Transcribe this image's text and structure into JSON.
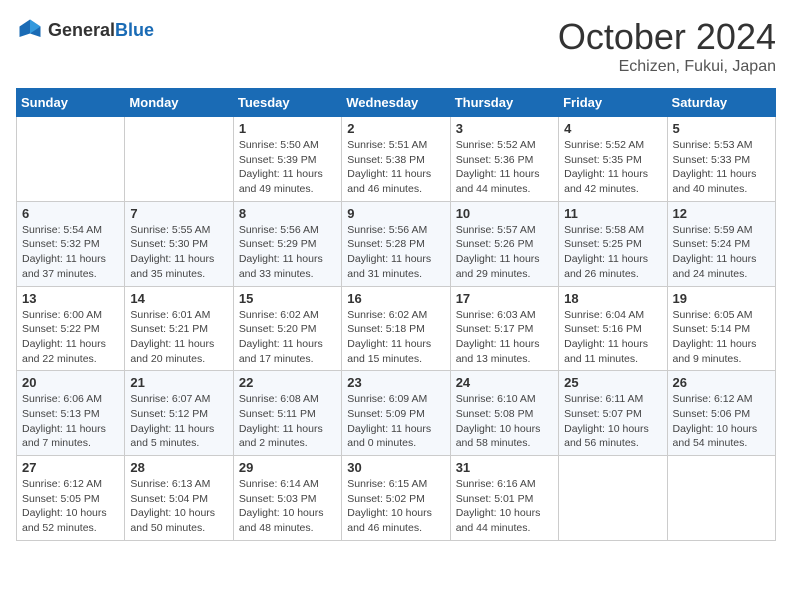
{
  "header": {
    "logo": {
      "general": "General",
      "blue": "Blue"
    },
    "title": "October 2024",
    "location": "Echizen, Fukui, Japan"
  },
  "days_of_week": [
    "Sunday",
    "Monday",
    "Tuesday",
    "Wednesday",
    "Thursday",
    "Friday",
    "Saturday"
  ],
  "weeks": [
    [
      {
        "day": "",
        "sunrise": "",
        "sunset": "",
        "daylight": ""
      },
      {
        "day": "",
        "sunrise": "",
        "sunset": "",
        "daylight": ""
      },
      {
        "day": "1",
        "sunrise": "Sunrise: 5:50 AM",
        "sunset": "Sunset: 5:39 PM",
        "daylight": "Daylight: 11 hours and 49 minutes."
      },
      {
        "day": "2",
        "sunrise": "Sunrise: 5:51 AM",
        "sunset": "Sunset: 5:38 PM",
        "daylight": "Daylight: 11 hours and 46 minutes."
      },
      {
        "day": "3",
        "sunrise": "Sunrise: 5:52 AM",
        "sunset": "Sunset: 5:36 PM",
        "daylight": "Daylight: 11 hours and 44 minutes."
      },
      {
        "day": "4",
        "sunrise": "Sunrise: 5:52 AM",
        "sunset": "Sunset: 5:35 PM",
        "daylight": "Daylight: 11 hours and 42 minutes."
      },
      {
        "day": "5",
        "sunrise": "Sunrise: 5:53 AM",
        "sunset": "Sunset: 5:33 PM",
        "daylight": "Daylight: 11 hours and 40 minutes."
      }
    ],
    [
      {
        "day": "6",
        "sunrise": "Sunrise: 5:54 AM",
        "sunset": "Sunset: 5:32 PM",
        "daylight": "Daylight: 11 hours and 37 minutes."
      },
      {
        "day": "7",
        "sunrise": "Sunrise: 5:55 AM",
        "sunset": "Sunset: 5:30 PM",
        "daylight": "Daylight: 11 hours and 35 minutes."
      },
      {
        "day": "8",
        "sunrise": "Sunrise: 5:56 AM",
        "sunset": "Sunset: 5:29 PM",
        "daylight": "Daylight: 11 hours and 33 minutes."
      },
      {
        "day": "9",
        "sunrise": "Sunrise: 5:56 AM",
        "sunset": "Sunset: 5:28 PM",
        "daylight": "Daylight: 11 hours and 31 minutes."
      },
      {
        "day": "10",
        "sunrise": "Sunrise: 5:57 AM",
        "sunset": "Sunset: 5:26 PM",
        "daylight": "Daylight: 11 hours and 29 minutes."
      },
      {
        "day": "11",
        "sunrise": "Sunrise: 5:58 AM",
        "sunset": "Sunset: 5:25 PM",
        "daylight": "Daylight: 11 hours and 26 minutes."
      },
      {
        "day": "12",
        "sunrise": "Sunrise: 5:59 AM",
        "sunset": "Sunset: 5:24 PM",
        "daylight": "Daylight: 11 hours and 24 minutes."
      }
    ],
    [
      {
        "day": "13",
        "sunrise": "Sunrise: 6:00 AM",
        "sunset": "Sunset: 5:22 PM",
        "daylight": "Daylight: 11 hours and 22 minutes."
      },
      {
        "day": "14",
        "sunrise": "Sunrise: 6:01 AM",
        "sunset": "Sunset: 5:21 PM",
        "daylight": "Daylight: 11 hours and 20 minutes."
      },
      {
        "day": "15",
        "sunrise": "Sunrise: 6:02 AM",
        "sunset": "Sunset: 5:20 PM",
        "daylight": "Daylight: 11 hours and 17 minutes."
      },
      {
        "day": "16",
        "sunrise": "Sunrise: 6:02 AM",
        "sunset": "Sunset: 5:18 PM",
        "daylight": "Daylight: 11 hours and 15 minutes."
      },
      {
        "day": "17",
        "sunrise": "Sunrise: 6:03 AM",
        "sunset": "Sunset: 5:17 PM",
        "daylight": "Daylight: 11 hours and 13 minutes."
      },
      {
        "day": "18",
        "sunrise": "Sunrise: 6:04 AM",
        "sunset": "Sunset: 5:16 PM",
        "daylight": "Daylight: 11 hours and 11 minutes."
      },
      {
        "day": "19",
        "sunrise": "Sunrise: 6:05 AM",
        "sunset": "Sunset: 5:14 PM",
        "daylight": "Daylight: 11 hours and 9 minutes."
      }
    ],
    [
      {
        "day": "20",
        "sunrise": "Sunrise: 6:06 AM",
        "sunset": "Sunset: 5:13 PM",
        "daylight": "Daylight: 11 hours and 7 minutes."
      },
      {
        "day": "21",
        "sunrise": "Sunrise: 6:07 AM",
        "sunset": "Sunset: 5:12 PM",
        "daylight": "Daylight: 11 hours and 5 minutes."
      },
      {
        "day": "22",
        "sunrise": "Sunrise: 6:08 AM",
        "sunset": "Sunset: 5:11 PM",
        "daylight": "Daylight: 11 hours and 2 minutes."
      },
      {
        "day": "23",
        "sunrise": "Sunrise: 6:09 AM",
        "sunset": "Sunset: 5:09 PM",
        "daylight": "Daylight: 11 hours and 0 minutes."
      },
      {
        "day": "24",
        "sunrise": "Sunrise: 6:10 AM",
        "sunset": "Sunset: 5:08 PM",
        "daylight": "Daylight: 10 hours and 58 minutes."
      },
      {
        "day": "25",
        "sunrise": "Sunrise: 6:11 AM",
        "sunset": "Sunset: 5:07 PM",
        "daylight": "Daylight: 10 hours and 56 minutes."
      },
      {
        "day": "26",
        "sunrise": "Sunrise: 6:12 AM",
        "sunset": "Sunset: 5:06 PM",
        "daylight": "Daylight: 10 hours and 54 minutes."
      }
    ],
    [
      {
        "day": "27",
        "sunrise": "Sunrise: 6:12 AM",
        "sunset": "Sunset: 5:05 PM",
        "daylight": "Daylight: 10 hours and 52 minutes."
      },
      {
        "day": "28",
        "sunrise": "Sunrise: 6:13 AM",
        "sunset": "Sunset: 5:04 PM",
        "daylight": "Daylight: 10 hours and 50 minutes."
      },
      {
        "day": "29",
        "sunrise": "Sunrise: 6:14 AM",
        "sunset": "Sunset: 5:03 PM",
        "daylight": "Daylight: 10 hours and 48 minutes."
      },
      {
        "day": "30",
        "sunrise": "Sunrise: 6:15 AM",
        "sunset": "Sunset: 5:02 PM",
        "daylight": "Daylight: 10 hours and 46 minutes."
      },
      {
        "day": "31",
        "sunrise": "Sunrise: 6:16 AM",
        "sunset": "Sunset: 5:01 PM",
        "daylight": "Daylight: 10 hours and 44 minutes."
      },
      {
        "day": "",
        "sunrise": "",
        "sunset": "",
        "daylight": ""
      },
      {
        "day": "",
        "sunrise": "",
        "sunset": "",
        "daylight": ""
      }
    ]
  ]
}
